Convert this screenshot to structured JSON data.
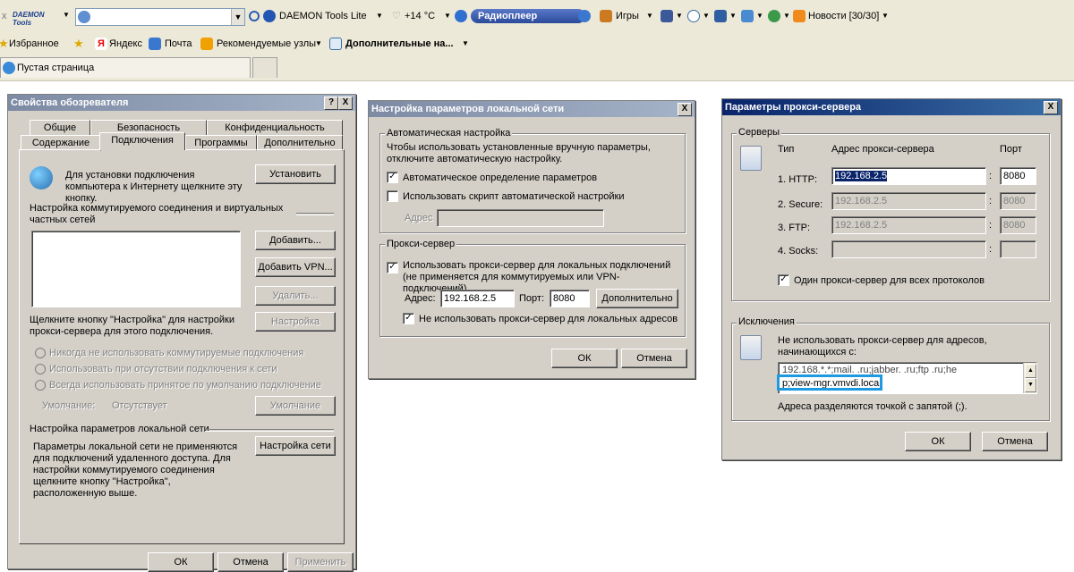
{
  "toolbar1": {
    "daemon_logo": "DAEMON Tools",
    "daemon_label": "DAEMON Tools Lite",
    "weather": "+14 °C",
    "radio": "Радиоплеер",
    "games": "Игры",
    "news": "Новости [30/30]"
  },
  "favbar": {
    "favorites": "Избранное",
    "yandex": "Яндекс",
    "mail": "Почта",
    "recommended": "Рекомендуемые узлы",
    "more": "Дополнительные на..."
  },
  "tabbar": {
    "tab": "Пустая страница"
  },
  "internet_options": {
    "title": "Свойства обозревателя",
    "help_btn": "?",
    "close_btn": "X",
    "tabs_row1": [
      "Общие",
      "Безопасность",
      "Конфиденциальность"
    ],
    "tabs_row2": [
      "Содержание",
      "Подключения",
      "Программы",
      "Дополнительно"
    ],
    "setup_text": "Для установки подключения компьютера к Интернету щелкните эту кнопку.",
    "setup_btn": "Установить",
    "dialup_label": "Настройка коммутируемого соединения и виртуальных частных сетей",
    "add_btn": "Добавить...",
    "add_vpn_btn": "Добавить VPN...",
    "remove_btn": "Удалить...",
    "proxy_hint": "Щелкните кнопку \"Настройка\" для настройки прокси-сервера для этого подключения.",
    "settings_btn": "Настройка",
    "radio_never": "Никогда не использовать коммутируемые подключения",
    "radio_absent": "Использовать при отсутствии подключения к сети",
    "radio_always": "Всегда использовать принятое по умолчанию подключение",
    "default_label": "Умолчание:",
    "default_value": "Отсутствует",
    "default_btn": "Умолчание",
    "lan_label": "Настройка параметров локальной сети",
    "lan_text": "Параметры локальной сети не применяются для подключений удаленного доступа. Для настройки коммутируемого соединения щелкните кнопку \"Настройка\", расположенную выше.",
    "lan_btn": "Настройка сети",
    "ok": "ОК",
    "cancel": "Отмена",
    "apply": "Применить"
  },
  "lan_settings": {
    "title": "Настройка параметров локальной сети",
    "close_btn": "X",
    "auto_group": "Автоматическая настройка",
    "auto_text": "Чтобы использовать установленные вручную параметры, отключите автоматическую настройку.",
    "auto_detect": "Автоматическое определение параметров",
    "auto_script": "Использовать скрипт автоматической настройки",
    "address_label": "Адрес",
    "proxy_group": "Прокси-сервер",
    "use_proxy": "Использовать прокси-сервер для локальных подключений (не применяется для коммутируемых или VPN-подключений).",
    "proxy_addr_label": "Адрес:",
    "proxy_addr": "192.168.2.5",
    "port_label": "Порт:",
    "port": "8080",
    "advanced_btn": "Дополнительно",
    "bypass_local": "Не использовать прокси-сервер для локальных адресов",
    "ok": "ОК",
    "cancel": "Отмена"
  },
  "proxy_settings": {
    "title": "Параметры прокси-сервера",
    "close_btn": "X",
    "servers_group": "Серверы",
    "col_type": "Тип",
    "col_address": "Адрес прокси-сервера",
    "col_port": "Порт",
    "rows": [
      {
        "label": "1. HTTP:",
        "address": "192.168.2.5",
        "port": "8080"
      },
      {
        "label": "2. Secure:",
        "address": "192.168.2.5",
        "port": "8080"
      },
      {
        "label": "3. FTP:",
        "address": "192.168.2.5",
        "port": "8080"
      },
      {
        "label": "4. Socks:",
        "address": "",
        "port": ""
      }
    ],
    "colon": ":",
    "same_proxy": "Один прокси-сервер для всех протоколов",
    "exceptions_group": "Исключения",
    "exceptions_text": "Не использовать прокси-сервер для адресов, начинающихся с:",
    "exceptions_line1": "192.168.*.*;mail.       .ru;jabber.     .ru;ftp       .ru;he",
    "exceptions_line2": "p;view-mgr.vmvdi.local",
    "exceptions_hint": "Адреса разделяются точкой с запятой (;).",
    "ok": "ОК",
    "cancel": "Отмена"
  },
  "colors": {
    "highlight": "#1e9be0",
    "title_active": "#0a246a",
    "dialog_bg": "#d4d0c8"
  }
}
